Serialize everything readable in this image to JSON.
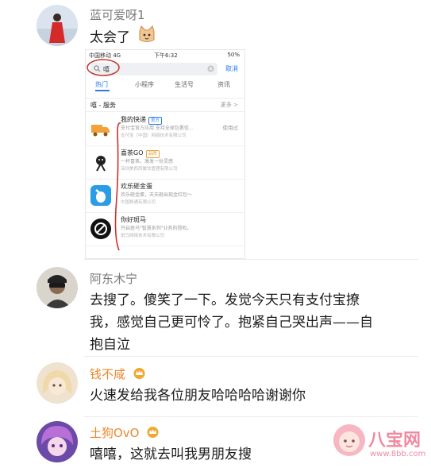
{
  "comments": [
    {
      "username": "蓝可爱呀1",
      "text": "太会了"
    },
    {
      "username": "阿东木宁",
      "text": "去搜了。傻笑了一下。发觉今天只有支付宝撩我，感觉自己更可怜了。抱紧自己哭出声——自抱自泣"
    },
    {
      "username": "钱不咸",
      "text": "火速发给我各位朋友哈哈哈哈谢谢你"
    },
    {
      "username": "土狗OvO",
      "text": "嘻嘻，这就去叫我男朋友搜"
    }
  ],
  "screenshot": {
    "status": {
      "carrier": "中国移动 4G",
      "time": "下午6:32",
      "battery": "50%"
    },
    "search": {
      "query": "嘻",
      "cancel": "取消"
    },
    "tabs": [
      "热门",
      "小程序",
      "生活号",
      "资讯"
    ],
    "section": {
      "title": "嘻 - 服务",
      "more": "更多 >"
    },
    "services": [
      {
        "name": "我的快递",
        "tag": "官方",
        "desc": "支付宝官方应用 支持全球包裹信…",
        "company": "支付宝（中国）网络技术有限公司",
        "action": "使用过",
        "color": "#f2a23a"
      },
      {
        "name": "喜茶GO",
        "tag": "品牌",
        "desc": "一杯喜茶，激发一份灵感",
        "company": "深圳美西西餐饮管理有限公司",
        "action": "",
        "color": "#2b2b2b"
      },
      {
        "name": "欢乐砸金蛋",
        "tag": "",
        "desc": "欢乐砸金蛋，天天砸出现金红包～",
        "company": "中国移通有限公司",
        "action": "",
        "color": "#2b9ce6"
      },
      {
        "name": "你好斑马",
        "tag": "",
        "desc": "开启斑马\"智慧系列\"业务的授权。",
        "company": "斑马网络技术有限公司",
        "action": "",
        "color": "#111111"
      }
    ]
  },
  "watermark": {
    "brand": "八宝网",
    "url": "www.8bb.com"
  },
  "colors": {
    "username_orange": "#e9882d",
    "username_gray": "#7a7a7a",
    "link_blue": "#2c7ae6",
    "annotation_red": "#c8322a"
  }
}
